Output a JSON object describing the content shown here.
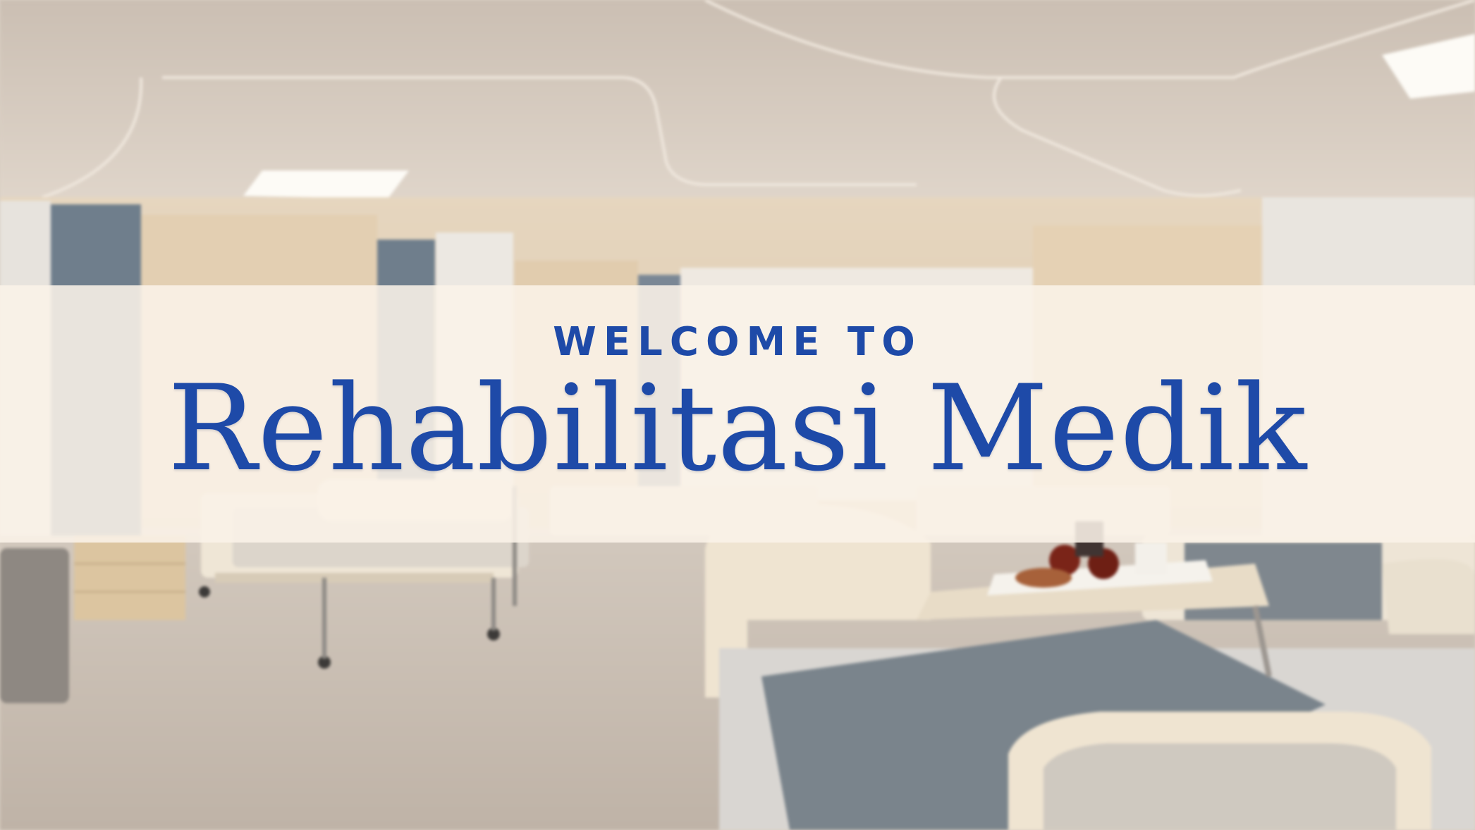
{
  "hero": {
    "welcome_text": "WELCOME TO",
    "title": "Rehabilitasi Medik"
  },
  "theme": {
    "text_color": "#1e4aa8",
    "banner_color": "#faf3e8",
    "floor_color": "#c8bdb2",
    "ceiling_color": "#d8cdc1",
    "bed_frame_color": "#efe6d6",
    "mattress_color": "#8c959c"
  },
  "background_image": "hospital-ward-photo"
}
